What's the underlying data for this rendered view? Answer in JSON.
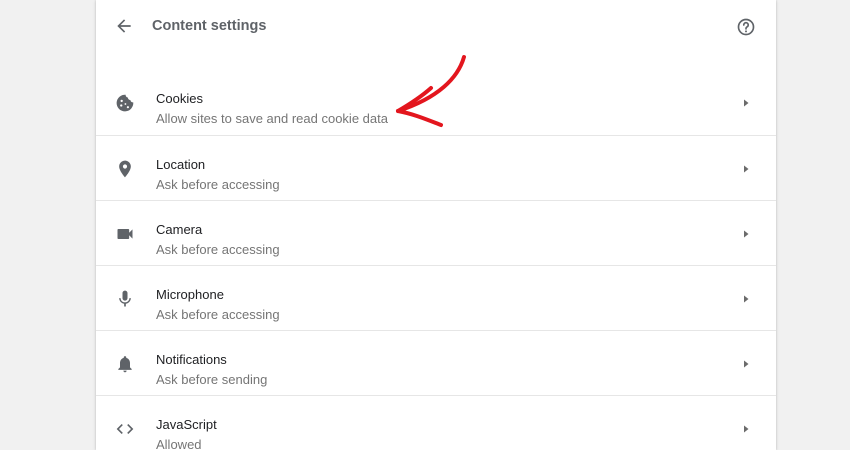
{
  "header": {
    "title": "Content settings",
    "back_icon": "arrow-back-icon",
    "help_icon": "help-circle-icon"
  },
  "rows": [
    {
      "title": "Cookies",
      "subtitle": "Allow sites to save and read cookie data",
      "icon": "cookie-icon"
    },
    {
      "title": "Location",
      "subtitle": "Ask before accessing",
      "icon": "location-pin-icon"
    },
    {
      "title": "Camera",
      "subtitle": "Ask before accessing",
      "icon": "videocam-icon"
    },
    {
      "title": "Microphone",
      "subtitle": "Ask before accessing",
      "icon": "microphone-icon"
    },
    {
      "title": "Notifications",
      "subtitle": "Ask before sending",
      "icon": "bell-icon"
    },
    {
      "title": "JavaScript",
      "subtitle": "Allowed",
      "icon": "code-icon"
    }
  ],
  "colors": {
    "annotation_arrow": "#e3161e",
    "icon": "#5f6368",
    "background": "#f1f1f1"
  }
}
